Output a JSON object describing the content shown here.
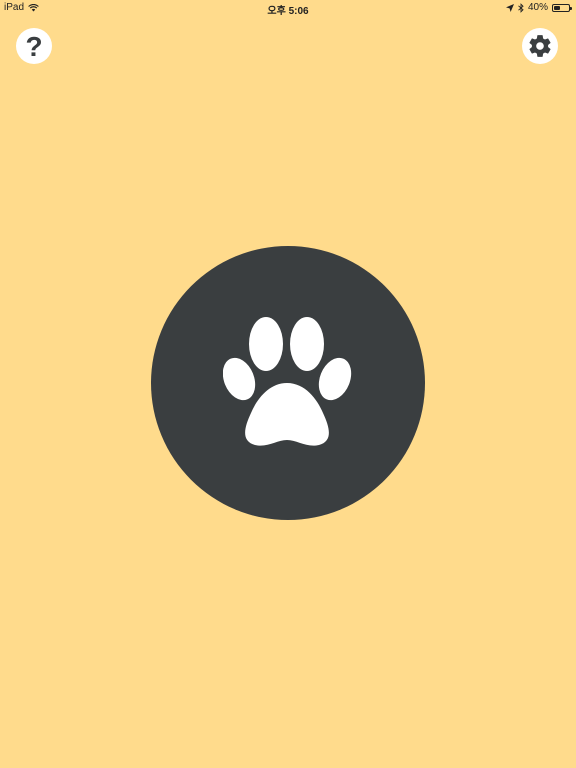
{
  "status_bar": {
    "device": "iPad",
    "time": "오후 5:06",
    "battery_percent": "40%",
    "battery_level": 0.4,
    "icons": [
      "wifi-icon",
      "location-arrow-icon",
      "bluetooth-icon",
      "battery-icon"
    ]
  },
  "header": {
    "help_label": "?",
    "help_icon": "question-mark-icon",
    "settings_icon": "gear-icon"
  },
  "main": {
    "paw_icon": "paw-icon"
  },
  "colors": {
    "background": "#FFDB8C",
    "button": "#3A3E40",
    "icon": "#FFFFFF"
  }
}
